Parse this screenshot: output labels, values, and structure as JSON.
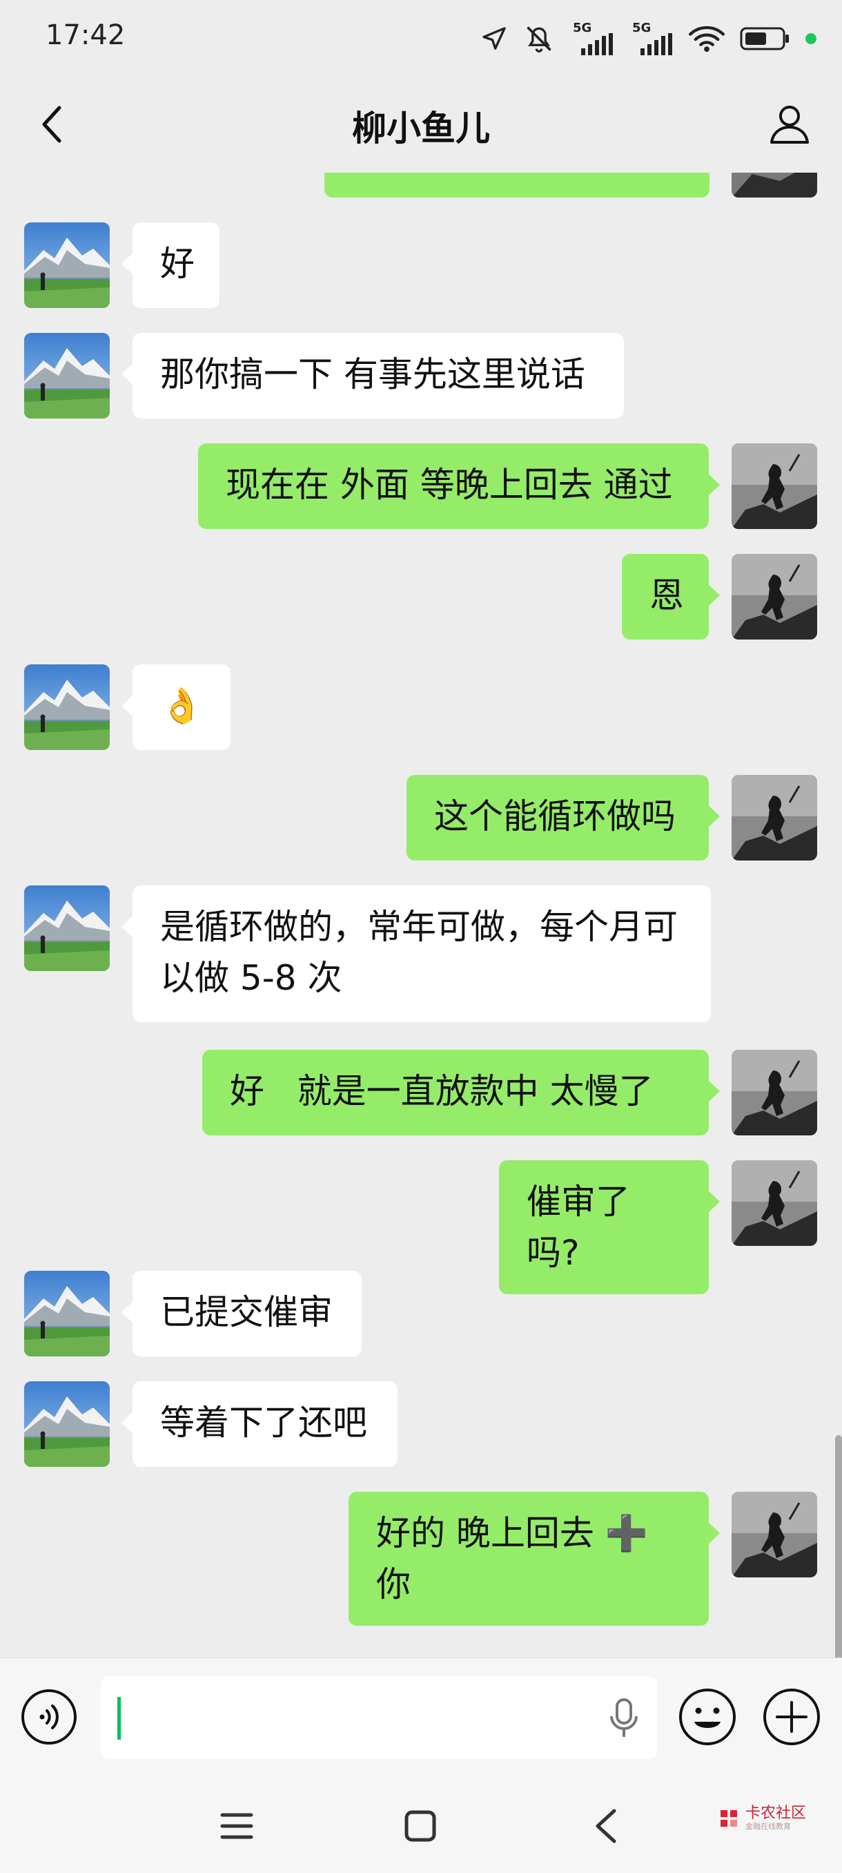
{
  "status_bar": {
    "time": "17:42",
    "network_1": "5G",
    "network_2": "5G",
    "icons": [
      "location-arrow-icon",
      "mute-vibrate-icon",
      "signal-5g-icon",
      "signal-5g-icon",
      "wifi-icon",
      "battery-icon",
      "dot-icon"
    ],
    "dot_color": "#22c55e"
  },
  "nav": {
    "title": "柳小鱼儿",
    "back_icon": "chevron-left-icon",
    "profile_icon": "person-icon"
  },
  "colors": {
    "background": "#ededed",
    "bubble_self": "#95ec69",
    "bubble_other": "#ffffff",
    "caret": "#07c160"
  },
  "messages": [
    {
      "side": "left",
      "text": "好"
    },
    {
      "side": "left",
      "text": "那你搞一下 有事先这里说话"
    },
    {
      "side": "right",
      "text": "现在在 外面 等晚上回去 通过"
    },
    {
      "side": "right",
      "text": "恩"
    },
    {
      "side": "left",
      "text": "👌"
    },
    {
      "side": "right",
      "text": "这个能循环做吗"
    },
    {
      "side": "left",
      "text": "是循环做的，常年可做，每个月可以做 5-8 次"
    },
    {
      "side": "right",
      "text": "好   就是一直放款中 太慢了"
    },
    {
      "side": "right",
      "text": "催审了吗?"
    },
    {
      "side": "left",
      "text": "已提交催审"
    },
    {
      "side": "left",
      "text": "等着下了还吧"
    },
    {
      "side": "right",
      "text": "好的 晚上回去 ➕ 你"
    }
  ],
  "input_bar": {
    "voice_icon": "voice-input-icon",
    "mic_icon": "microphone-icon",
    "emoji_icon": "emoji-icon",
    "plus_icon": "plus-circle-icon",
    "value": ""
  },
  "system_nav": {
    "icons": [
      "menu-icon",
      "home-icon",
      "back-icon"
    ]
  },
  "watermark": {
    "text": "卡农社区",
    "sub": "金融在线教育"
  }
}
